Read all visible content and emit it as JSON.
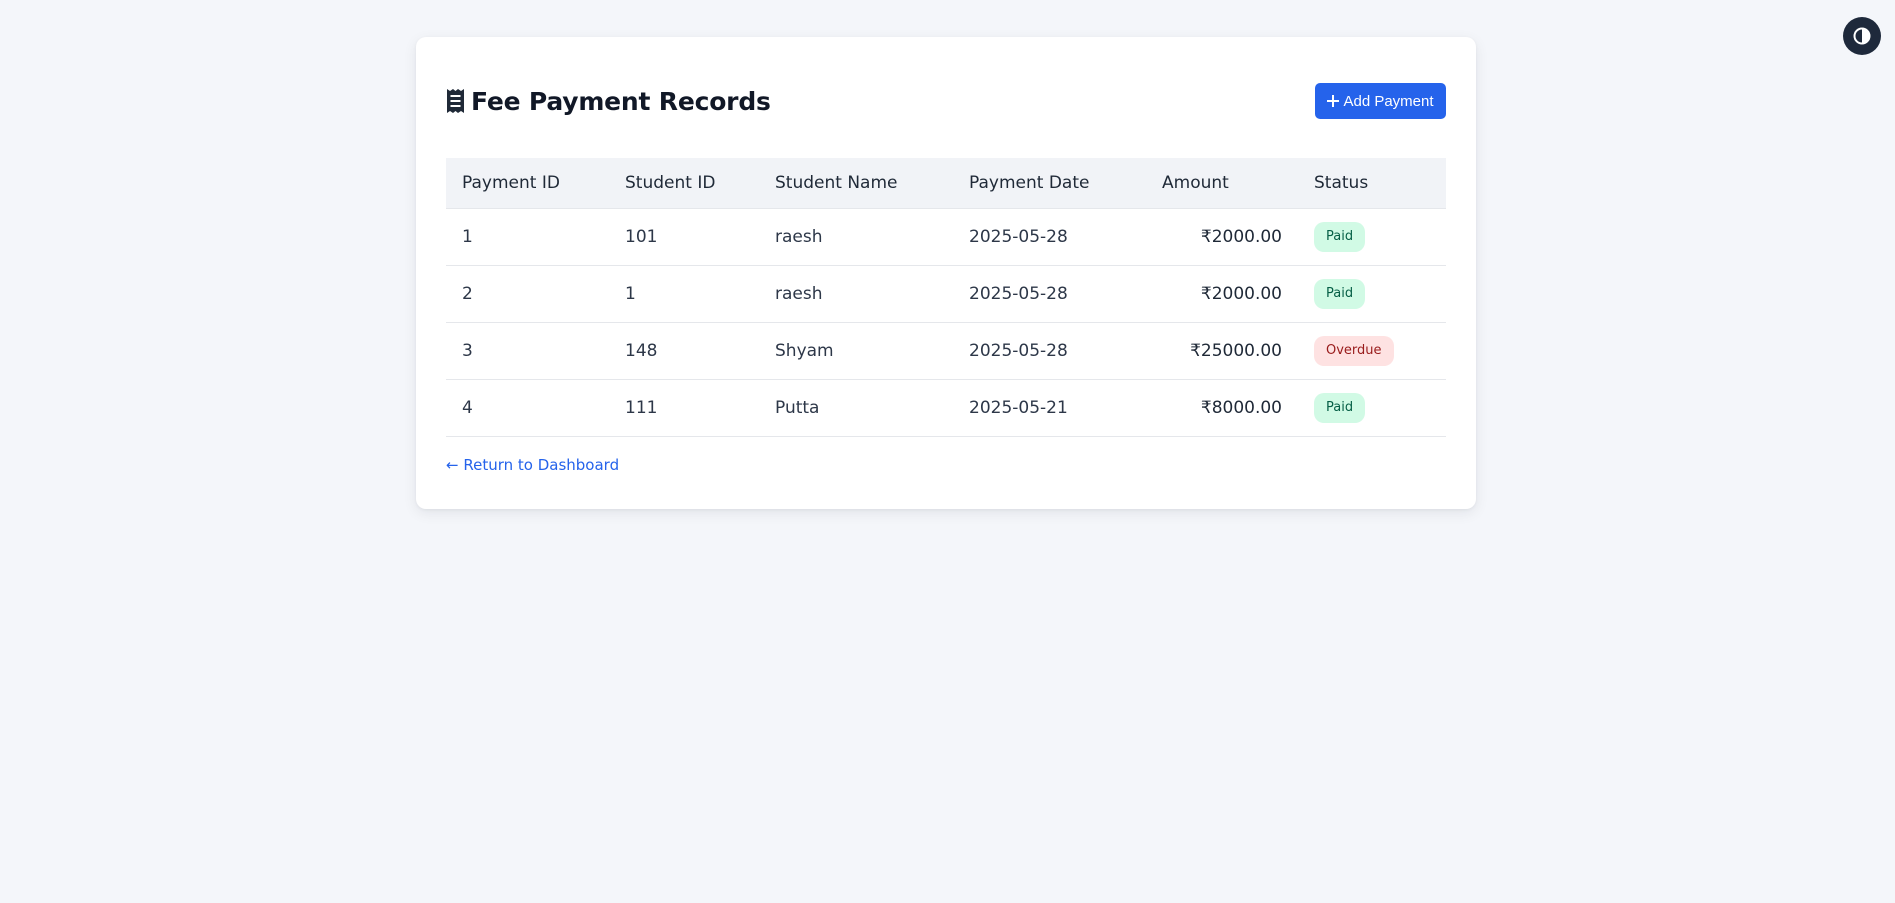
{
  "theme_toggle": {
    "icon": "contrast-icon"
  },
  "header": {
    "title": "Fee Payment Records",
    "title_icon": "receipt-icon",
    "add_button_label": "Add Payment",
    "add_button_icon": "plus-icon"
  },
  "table": {
    "columns": [
      "Payment ID",
      "Student ID",
      "Student Name",
      "Payment Date",
      "Amount",
      "Status"
    ],
    "rows": [
      {
        "payment_id": "1",
        "student_id": "101",
        "student_name": "raesh",
        "payment_date": "2025-05-28",
        "amount": "₹2000.00",
        "status": "Paid"
      },
      {
        "payment_id": "2",
        "student_id": "1",
        "student_name": "raesh",
        "payment_date": "2025-05-28",
        "amount": "₹2000.00",
        "status": "Paid"
      },
      {
        "payment_id": "3",
        "student_id": "148",
        "student_name": "Shyam",
        "payment_date": "2025-05-28",
        "amount": "₹25000.00",
        "status": "Overdue"
      },
      {
        "payment_id": "4",
        "student_id": "111",
        "student_name": "Putta",
        "payment_date": "2025-05-21",
        "amount": "₹8000.00",
        "status": "Paid"
      }
    ]
  },
  "footer": {
    "back_link": "← Return to Dashboard"
  },
  "colors": {
    "accent": "#2563eb",
    "paid_bg": "#d1fae5",
    "paid_text": "#065f46",
    "overdue_bg": "#fee2e2",
    "overdue_text": "#991b1b"
  }
}
